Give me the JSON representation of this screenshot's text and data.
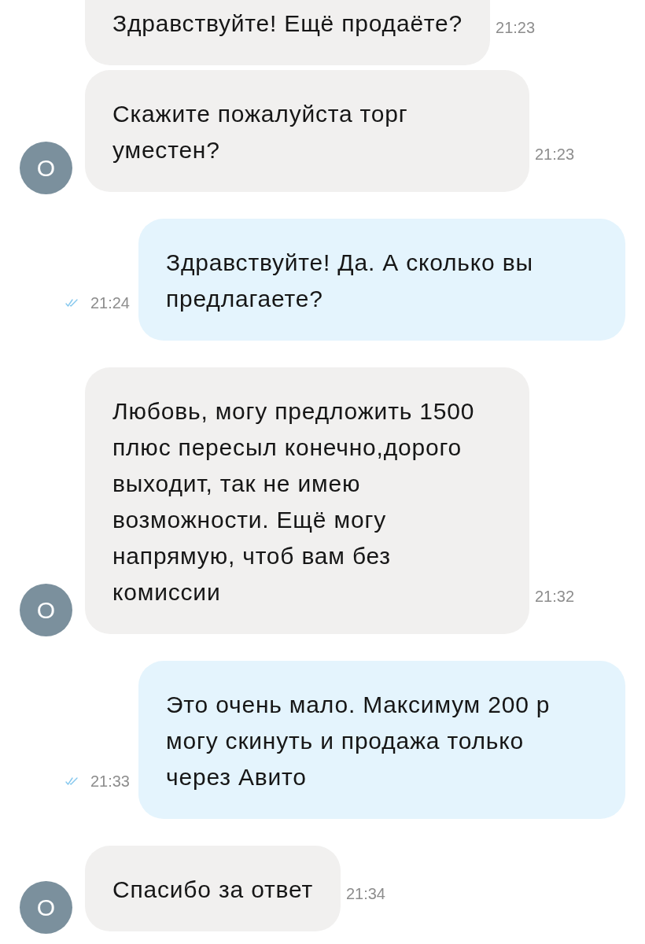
{
  "messages": [
    {
      "kind": "incoming",
      "text": "Здравствуйте! Ещё продаёте?",
      "time": "21:23"
    },
    {
      "kind": "incoming",
      "text": "Скажите пожалуйста торг уместен?",
      "time": "21:23",
      "avatar": "О"
    },
    {
      "kind": "outgoing",
      "text": "Здравствуйте! Да. А сколько вы предлагаете?",
      "time": "21:24",
      "read": true
    },
    {
      "kind": "incoming",
      "text": "Любовь, могу предложить 1500 плюс пересыл конечно,дорого выходит, так не имею возможности. Ещё могу напрямую, чтоб вам без комиссии",
      "time": "21:32",
      "avatar": "О"
    },
    {
      "kind": "outgoing",
      "text": "Это очень мало. Максимум 200 р могу скинуть и продажа только через Авито",
      "time": "21:33",
      "read": true
    },
    {
      "kind": "incoming",
      "text": "Спасибо за ответ",
      "time": "21:34",
      "avatar": "О"
    }
  ]
}
